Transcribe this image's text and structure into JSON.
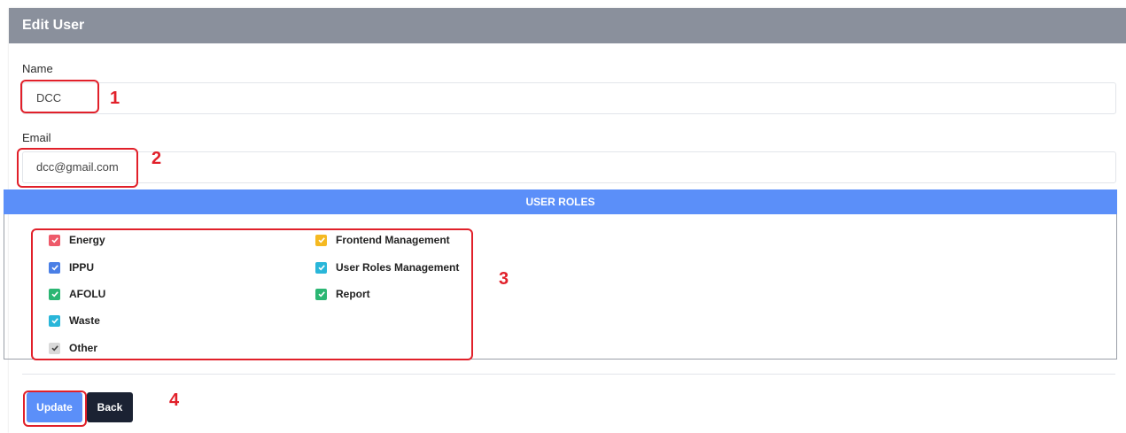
{
  "header": {
    "title": "Edit User"
  },
  "form": {
    "name_label": "Name",
    "name_value": "DCC",
    "email_label": "Email",
    "email_value": "dcc@gmail.com"
  },
  "roles": {
    "title": "USER ROLES",
    "left": [
      {
        "label": "Energy",
        "checked": true,
        "color": "#ee5a6a"
      },
      {
        "label": "IPPU",
        "checked": true,
        "color": "#4a7fe6"
      },
      {
        "label": "AFOLU",
        "checked": true,
        "color": "#2bb673"
      },
      {
        "label": "Waste",
        "checked": true,
        "color": "#29b6d9"
      },
      {
        "label": "Other",
        "checked": true,
        "color": "#d9d9d9"
      }
    ],
    "right": [
      {
        "label": "Frontend Management",
        "checked": true,
        "color": "#f5b921"
      },
      {
        "label": "User Roles Management",
        "checked": true,
        "color": "#29b6d9"
      },
      {
        "label": "Report",
        "checked": true,
        "color": "#2bb673"
      }
    ]
  },
  "buttons": {
    "update_label": "Update",
    "back_label": "Back"
  },
  "annotations": [
    "1",
    "2",
    "3",
    "4"
  ],
  "colors": {
    "header_bg": "#8a909c",
    "roles_header_bg": "#5b8ff9",
    "update_bg": "#5b8ff9",
    "back_bg": "#1b2233",
    "annotation_red": "#e1202a"
  }
}
